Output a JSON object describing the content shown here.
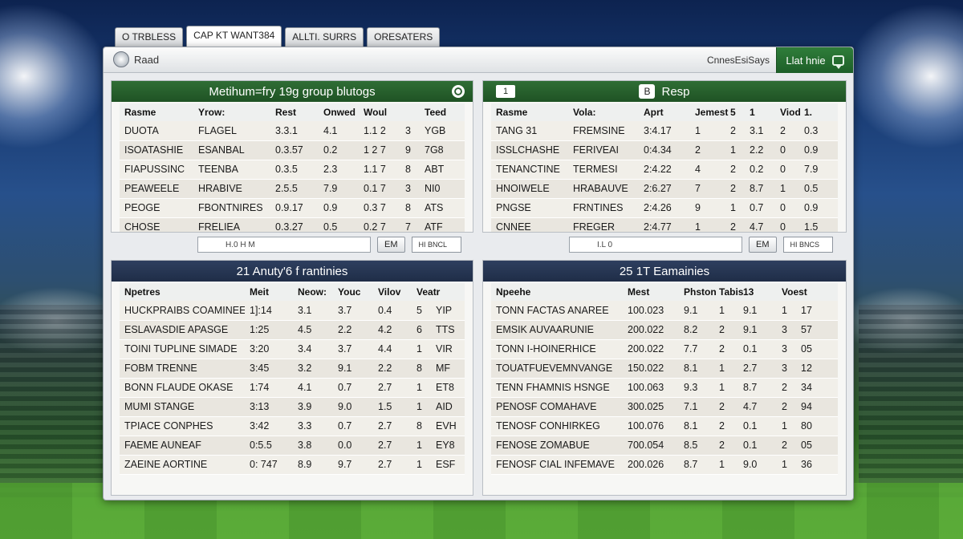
{
  "tabs": [
    "O TRBLESS",
    "CAP KT WANT384",
    "ALLTI. SURRS",
    "ORESATERS"
  ],
  "topbar": {
    "home_label": "Raad",
    "status_text": "CnnesEsiSays",
    "live_label": "Llat hnie"
  },
  "panel_top_left": {
    "title": "Metihum=fry 19g group blutogs",
    "columns": [
      "Rasme",
      "Yrow:",
      "Rest",
      "Onwed",
      "Woul",
      "",
      "Teed"
    ],
    "rows": [
      [
        "DUOTA",
        "FLAGEL",
        "3.3.1",
        "4.1",
        "1.1 2",
        "3",
        "YGB"
      ],
      [
        "ISOATASHIE",
        "ESANBAL",
        "0.3.57",
        "0.2",
        "1 2 7",
        "9",
        "7G8"
      ],
      [
        "FIAPUSSINC",
        "TEENBA",
        "0.3.5",
        "2.3",
        "1.1 7",
        "8",
        "ABT"
      ],
      [
        "PEAWEELE",
        "HRABIVE",
        "2.5.5",
        "7.9",
        "0.1 7",
        "3",
        "NI0"
      ],
      [
        "PEOGE",
        "FBONTNIRES",
        "0.9.17",
        "0.9",
        "0.3 7",
        "8",
        "ATS"
      ],
      [
        "CHOSE",
        "FRELIEA",
        "0.3.27",
        "0.5",
        "0.2 7",
        "7",
        "ATF"
      ]
    ],
    "input_text": "H.0 H M",
    "btn1": "EM",
    "btn2": "HI BNCL"
  },
  "panel_top_right": {
    "badge": "1",
    "resp_icon": "B",
    "title": "Resp",
    "columns": [
      "Rasme",
      "Vola:",
      "Aprt",
      "Jemest",
      "5",
      "1",
      "Viod",
      "1."
    ],
    "rows": [
      [
        "TANG 31",
        "FREMSINE",
        "3:4.17",
        "1",
        "2",
        "3.1",
        "2",
        "0.3"
      ],
      [
        "ISSLCHASHE",
        "FERIVEAI",
        "0:4.34",
        "2",
        "1",
        "2.2",
        "0",
        "0.9"
      ],
      [
        "TENANCTINE",
        "TERMESI",
        "2:4.22",
        "4",
        "2",
        "0.2",
        "0",
        "7.9"
      ],
      [
        "HNOIWELE",
        "HRABAUVE",
        "2:6.27",
        "7",
        "2",
        "8.7",
        "1",
        "0.5"
      ],
      [
        "PNGSE",
        "FRNTINES",
        "2:4.26",
        "9",
        "1",
        "0.7",
        "0",
        "0.9"
      ],
      [
        "CNNEE",
        "FREGER",
        "2:4.77",
        "1",
        "2",
        "4.7",
        "0",
        "1.5"
      ]
    ],
    "input_text": "I.L 0",
    "btn1": "EM",
    "btn2": "HI BNCS"
  },
  "panel_bottom_left": {
    "title": "21 Anuty'6 f rantinies",
    "columns": [
      "Npetres",
      "Meit",
      "Neow:",
      "Youc",
      "Vilov",
      "Veatr"
    ],
    "rows": [
      [
        "HUCKPRAIBS COAMINEE",
        "1]:14",
        "3.1",
        "3.7",
        "0.4",
        "5",
        "YIP"
      ],
      [
        "ESLAVASDIE APASGE",
        "1:25",
        "4.5",
        "2.2",
        "4.2",
        "6",
        "TTS"
      ],
      [
        "TOINI TUPLINE SIMADE",
        "3:20",
        "3.4",
        "3.7",
        "4.4",
        "1",
        "VIR"
      ],
      [
        "FOBM TRENNE",
        "3:45",
        "3.2",
        "9.1",
        "2.2",
        "8",
        "MF"
      ],
      [
        "BONN FLAUDE OKASE",
        "1:74",
        "4.1",
        "0.7",
        "2.7",
        "1",
        "ET8"
      ],
      [
        "MUMI STANGE",
        "3:13",
        "3.9",
        "9.0",
        "1.5",
        "1",
        "AID"
      ],
      [
        "TPIACE CONPHES",
        "3:42",
        "3.3",
        "0.7",
        "2.7",
        "8",
        "EVH"
      ],
      [
        "FAEME AUNEAF",
        "0:5.5",
        "3.8",
        "0.0",
        "2.7",
        "1",
        "EY8"
      ],
      [
        "ZAEINE AORTINE",
        "0: 747",
        "8.9",
        "9.7",
        "2.7",
        "1",
        "ESF"
      ]
    ]
  },
  "panel_bottom_right": {
    "title": "25 1T Eamainies",
    "columns": [
      "Npeehe",
      "Mest",
      "Phston",
      "Tabis",
      "13",
      "Voest"
    ],
    "rows": [
      [
        "TONN FACTAS ANAREE",
        "100.023",
        "9.1",
        "1",
        "9.1",
        "1",
        "17"
      ],
      [
        "EMSIK AUVAARUNIE",
        "200.022",
        "8.2",
        "2",
        "9.1",
        "3",
        "57"
      ],
      [
        "TONN I-HOINERHICE",
        "200.022",
        "7.7",
        "2",
        "0.1",
        "3",
        "05"
      ],
      [
        "TOUATFUEVEMNVANGE",
        "150.022",
        "8.1",
        "1",
        "2.7",
        "3",
        "12"
      ],
      [
        "TENN FHAMNIS HSNGE",
        "100.063",
        "9.3",
        "1",
        "8.7",
        "2",
        "34"
      ],
      [
        "PENOSF COMAHAVE",
        "300.025",
        "7.1",
        "2",
        "4.7",
        "2",
        "94"
      ],
      [
        "TENOSF CONHIRKEG",
        "100.076",
        "8.1",
        "2",
        "0.1",
        "1",
        "80"
      ],
      [
        "FENOSE ZOMABUE",
        "700.054",
        "8.5",
        "2",
        "0.1",
        "2",
        "05"
      ],
      [
        "FENOSF CIAL INFEMAVE",
        "200.026",
        "8.7",
        "1",
        "9.0",
        "1",
        "36"
      ]
    ]
  }
}
